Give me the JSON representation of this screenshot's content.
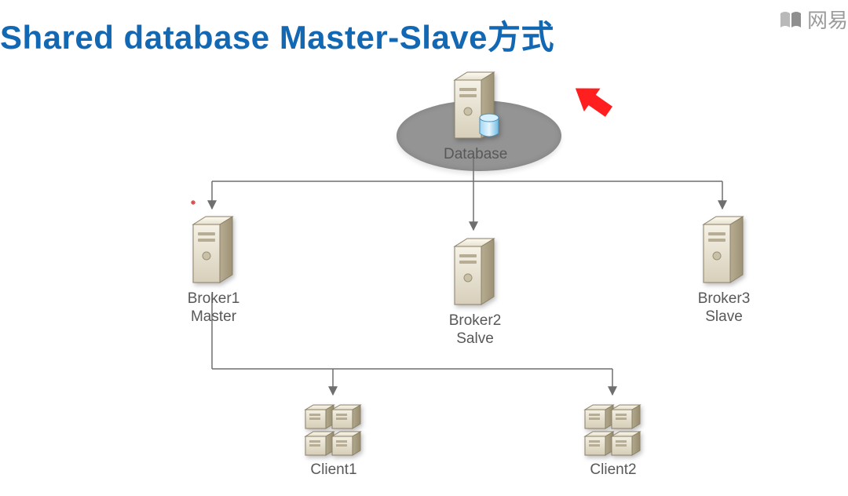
{
  "title": "Shared database Master-Slave方式",
  "watermark_text": "网易",
  "nodes": {
    "database": {
      "label": "Database"
    },
    "broker1": {
      "label": "Broker1\nMaster"
    },
    "broker2": {
      "label": "Broker2\nSalve"
    },
    "broker3": {
      "label": "Broker3\nSlave"
    },
    "client1": {
      "label": "Client1"
    },
    "client2": {
      "label": "Client2"
    }
  },
  "diagram": {
    "relationships": [
      "Database is highlighted with a red arrow and a grey spotlight ellipse.",
      "Database connects down to Broker1 Master, Broker2 Salve, Broker3 Slave.",
      "Broker1 Master connects down to Client1 and Client2."
    ]
  }
}
